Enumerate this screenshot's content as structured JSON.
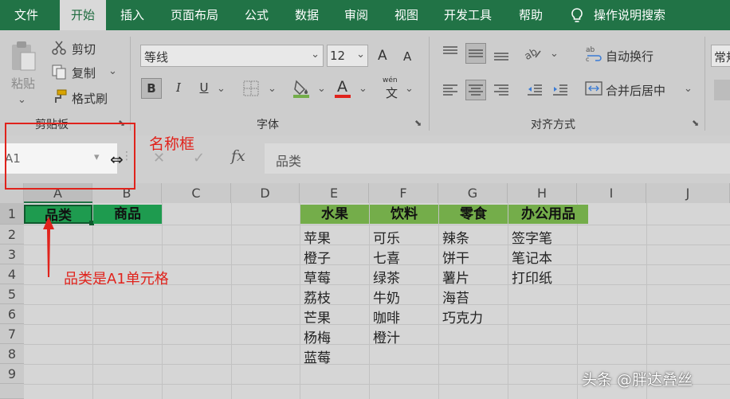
{
  "menu": {
    "tabs": [
      "文件",
      "开始",
      "插入",
      "页面布局",
      "公式",
      "数据",
      "审阅",
      "视图",
      "开发工具",
      "帮助"
    ],
    "active_index": 1,
    "search_label": "操作说明搜索"
  },
  "ribbon": {
    "clipboard": {
      "paste": "粘贴",
      "cut": "剪切",
      "copy": "复制",
      "format_painter": "格式刷",
      "label": "剪贴板"
    },
    "font": {
      "font_name": "等线",
      "font_size": "12",
      "grow": "A",
      "shrink": "A",
      "bold": "B",
      "italic": "I",
      "underline": "U",
      "fill_letter": "A",
      "wen": "wén",
      "wen_char": "文",
      "label": "字体"
    },
    "alignment": {
      "wrap_text": "自动换行",
      "merge_center": "合并后居中",
      "label": "对齐方式"
    },
    "number": {
      "format": "常规"
    }
  },
  "formula_bar": {
    "name_box": "A1",
    "fx": "fx",
    "content": "品类"
  },
  "annotations": {
    "name_box_label": "名称框",
    "cell_label": "品类是A1单元格"
  },
  "grid": {
    "columns": [
      "A",
      "B",
      "C",
      "D",
      "E",
      "F",
      "G",
      "H",
      "I",
      "J"
    ],
    "rows": [
      "1",
      "2",
      "3",
      "4",
      "5",
      "6",
      "7",
      "8",
      "9"
    ],
    "header_row": {
      "A": "品类",
      "B": "商品",
      "E": "水果",
      "F": "饮料",
      "G": "零食",
      "H": "办公用品"
    },
    "col_E": [
      "苹果",
      "橙子",
      "草莓",
      "荔枝",
      "芒果",
      "杨梅",
      "蓝莓"
    ],
    "col_F": [
      "可乐",
      "七喜",
      "绿茶",
      "牛奶",
      "咖啡",
      "橙汁"
    ],
    "col_G": [
      "辣条",
      "饼干",
      "薯片",
      "海苔",
      "巧克力"
    ],
    "col_H": [
      "签字笔",
      "笔记本",
      "打印纸"
    ]
  },
  "watermark": "头条 @胖达叠丝",
  "colors": {
    "excel_green": "#217346",
    "header_green": "#1e9b4f",
    "light_green": "#74ad4a",
    "annotation_red": "#e0231c"
  }
}
